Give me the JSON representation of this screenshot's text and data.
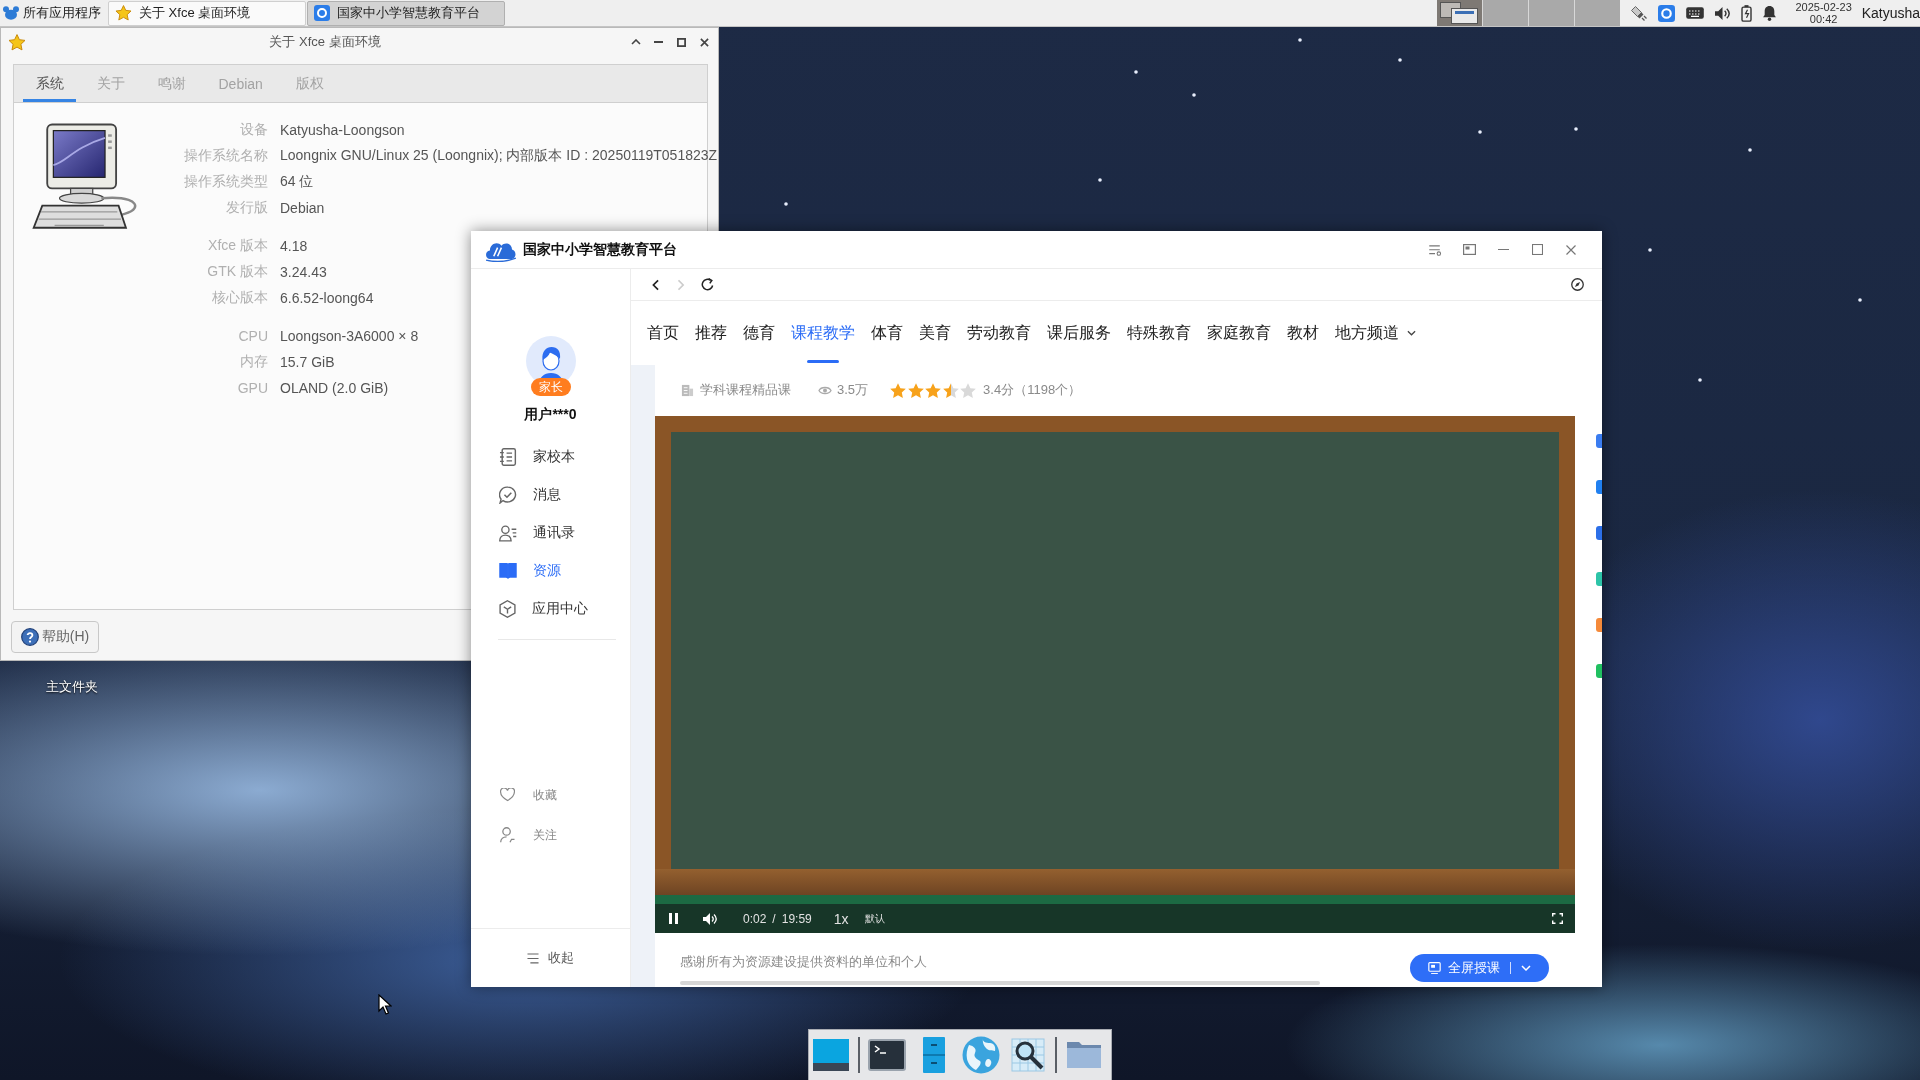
{
  "top_panel": {
    "menu": {
      "label": "所有应用程序"
    },
    "tasks": [
      {
        "label": "关于 Xfce 桌面环境",
        "kind": "about",
        "selected": false
      },
      {
        "label": "国家中小学智慧教育平台",
        "kind": "browser",
        "selected": true
      }
    ],
    "workspaces": [
      {
        "selected": true
      },
      {
        "selected": false
      },
      {
        "selected": false
      },
      {
        "selected": false
      }
    ],
    "tray": [
      {
        "kind": "network"
      },
      {
        "kind": "app"
      },
      {
        "kind": "keyboard"
      },
      {
        "kind": "volume"
      },
      {
        "kind": "power"
      },
      {
        "kind": "notifications"
      }
    ],
    "clock": {
      "date": "2025-02-23",
      "time": "00:42"
    },
    "user": "Katyusha"
  },
  "about_window": {
    "title": "关于 Xfce 桌面环境",
    "tabs": [
      {
        "label": "系统",
        "selected": true
      },
      {
        "label": "关于",
        "selected": false
      },
      {
        "label": "鸣谢",
        "selected": false
      },
      {
        "label": "Debian",
        "selected": false
      },
      {
        "label": "版权",
        "selected": false
      }
    ],
    "info_groups": [
      {
        "rows": [
          {
            "label": "设备",
            "value": "Katyusha-Loongson"
          },
          {
            "label": "操作系统名称",
            "value": "Loongnix GNU/Linux 25 (Loongnix); 内部版本 ID : 20250119T051823Z"
          },
          {
            "label": "操作系统类型",
            "value": "64 位"
          },
          {
            "label": "发行版",
            "value": "Debian"
          }
        ]
      },
      {
        "rows": [
          {
            "label": "Xfce 版本",
            "value": "4.18"
          },
          {
            "label": "GTK 版本",
            "value": "3.24.43"
          },
          {
            "label": "核心版本",
            "value": "6.6.52-loong64"
          }
        ]
      },
      {
        "rows": [
          {
            "label": "CPU",
            "value": "Loongson-3A6000 × 8"
          },
          {
            "label": "内存",
            "value": "15.7 GiB"
          },
          {
            "label": "GPU",
            "value": "OLAND (2.0 GiB)"
          }
        ]
      }
    ],
    "help_button": "帮助(H)"
  },
  "desktop": {
    "items": [
      {
        "label": "主文件夹"
      }
    ]
  },
  "browser_window": {
    "title": "国家中小学智慧教育平台",
    "sidebar": {
      "user": {
        "name": "用户***0",
        "badge": "家长"
      },
      "menu": [
        {
          "label": "家校本",
          "kind": "notebook",
          "selected": false
        },
        {
          "label": "消息",
          "kind": "messages",
          "selected": false
        },
        {
          "label": "通讯录",
          "kind": "contacts",
          "selected": false
        },
        {
          "label": "资源",
          "kind": "resources",
          "selected": true
        },
        {
          "label": "应用中心",
          "kind": "apps",
          "selected": false
        }
      ],
      "links": [
        {
          "label": "收藏",
          "kind": "favorites"
        },
        {
          "label": "关注",
          "kind": "follow"
        }
      ],
      "collapse": "收起"
    },
    "nav_buttons": [
      {
        "kind": "back",
        "disabled": false
      },
      {
        "kind": "forward",
        "disabled": true
      },
      {
        "kind": "reload",
        "disabled": false
      }
    ],
    "nav_tabs": [
      {
        "label": "首页",
        "kind": "link",
        "selected": false
      },
      {
        "label": "推荐",
        "kind": "link",
        "selected": false
      },
      {
        "label": "德育",
        "kind": "link",
        "selected": false
      },
      {
        "label": "课程教学",
        "kind": "link",
        "selected": true
      },
      {
        "label": "体育",
        "kind": "link",
        "selected": false
      },
      {
        "label": "美育",
        "kind": "link",
        "selected": false
      },
      {
        "label": "劳动教育",
        "kind": "link",
        "selected": false
      },
      {
        "label": "课后服务",
        "kind": "link",
        "selected": false
      },
      {
        "label": "特殊教育",
        "kind": "link",
        "selected": false
      },
      {
        "label": "家庭教育",
        "kind": "link",
        "selected": false
      },
      {
        "label": "教材",
        "kind": "link",
        "selected": false
      },
      {
        "label": "地方频道",
        "kind": "dropdown",
        "selected": false
      }
    ],
    "course_info": {
      "category": "学科课程精品课",
      "views": "3.5万",
      "stars": 3.5,
      "rating": "3.4分（1198个）"
    },
    "video": {
      "playing": true,
      "current_time": "0:02",
      "separator": "/",
      "duration": "19:59",
      "speed": "1x",
      "quality": "默认"
    },
    "credit": "感谢所有为资源建设提供资料的单位和个人",
    "action_button": "全屏授课",
    "side_tools": [
      {
        "color": "#3a7cf0"
      },
      {
        "color": "#2080f0"
      },
      {
        "color": "#2c6fe8"
      },
      {
        "color": "#2dc4a8"
      },
      {
        "color": "#f58a3a"
      },
      {
        "color": "#20c060"
      }
    ]
  },
  "dock": {
    "items": [
      {
        "kind": "desktop"
      },
      {
        "kind": "separator"
      },
      {
        "kind": "terminal"
      },
      {
        "kind": "files"
      },
      {
        "kind": "browser"
      },
      {
        "kind": "search"
      },
      {
        "kind": "separator"
      },
      {
        "kind": "folder"
      }
    ]
  }
}
